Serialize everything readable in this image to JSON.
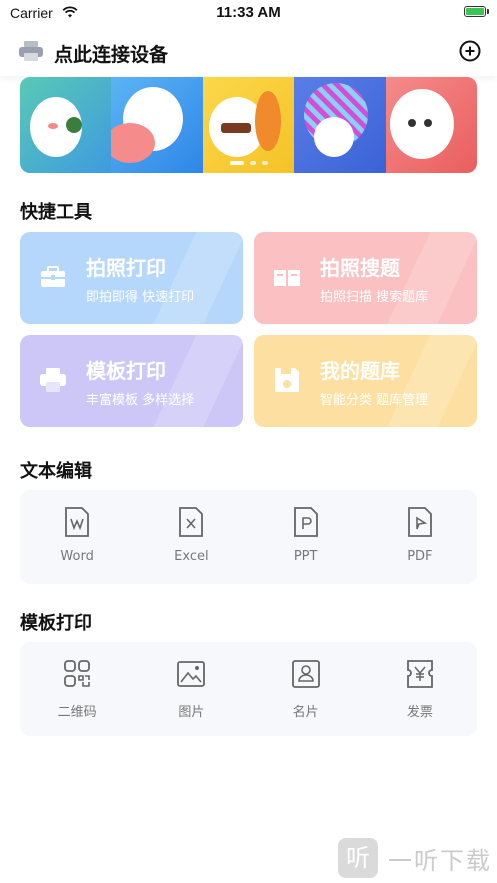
{
  "status_bar": {
    "carrier": "Carrier",
    "time": "11:33 AM"
  },
  "header": {
    "title": "点此连接设备"
  },
  "banner": {
    "dot_count": 3
  },
  "quick_tools": {
    "title": "快捷工具",
    "cards": [
      {
        "title": "拍照打印",
        "subtitle": "即拍即得 快速打印",
        "color": "#b5d7fb",
        "icon": "toolbox-icon"
      },
      {
        "title": "拍照搜题",
        "subtitle": "拍照扫描 搜索题库",
        "color": "#fbc0c1",
        "icon": "book-icon"
      },
      {
        "title": "模板打印",
        "subtitle": "丰富模板 多样选择",
        "color": "#cdc7f8",
        "icon": "printer-icon"
      },
      {
        "title": "我的题库",
        "subtitle": "智能分类 题库管理",
        "color": "#fde0a1",
        "icon": "save-icon"
      }
    ]
  },
  "text_edit": {
    "title": "文本编辑",
    "items": [
      {
        "label": "Word",
        "icon": "word-file-icon"
      },
      {
        "label": "Excel",
        "icon": "excel-file-icon"
      },
      {
        "label": "PPT",
        "icon": "ppt-file-icon"
      },
      {
        "label": "PDF",
        "icon": "pdf-file-icon"
      }
    ]
  },
  "template_print": {
    "title": "模板打印",
    "items": [
      {
        "label": "二维码",
        "icon": "qrcode-icon"
      },
      {
        "label": "图片",
        "icon": "image-icon"
      },
      {
        "label": "名片",
        "icon": "business-card-icon"
      },
      {
        "label": "发票",
        "icon": "invoice-icon"
      }
    ]
  },
  "watermark": {
    "glyph": "听",
    "text": "一听下载"
  }
}
